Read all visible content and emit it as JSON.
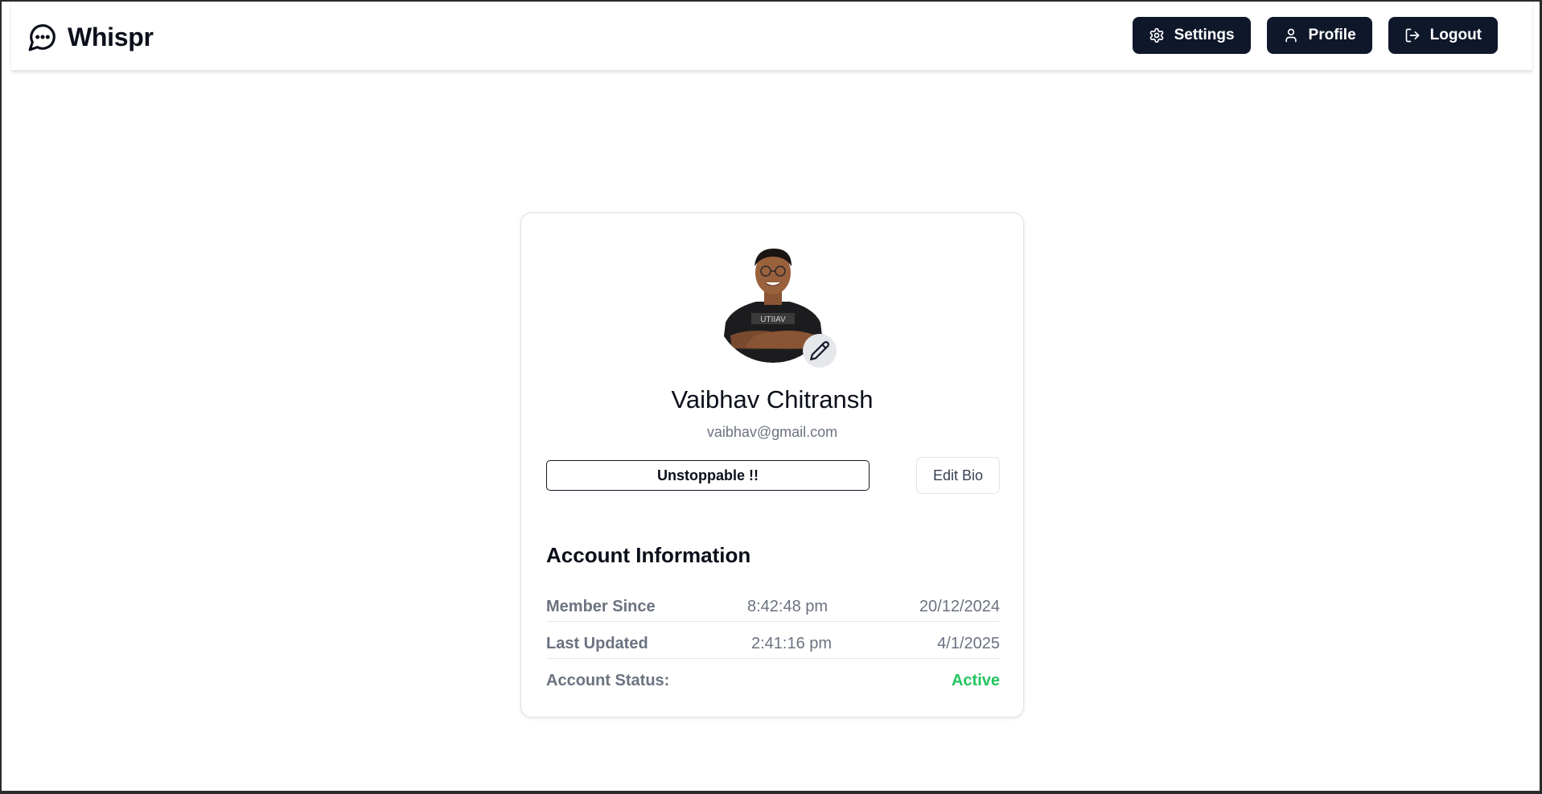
{
  "app": {
    "name": "Whispr"
  },
  "nav": {
    "settings_label": "Settings",
    "profile_label": "Profile",
    "logout_label": "Logout"
  },
  "profile": {
    "name": "Vaibhav Chitransh",
    "email": "vaibhav@gmail.com",
    "bio": "Unstoppable !!",
    "edit_bio_label": "Edit Bio",
    "avatar_alt": "profile photo"
  },
  "account": {
    "title": "Account Information",
    "member_since": {
      "label": "Member Since",
      "time": "8:42:48 pm",
      "date": "20/12/2024"
    },
    "last_updated": {
      "label": "Last Updated",
      "time": "2:41:16 pm",
      "date": "4/1/2025"
    },
    "status": {
      "label": "Account Status:",
      "value": "Active"
    }
  },
  "colors": {
    "primary_button": "#0f172a",
    "status_active": "#22c55e",
    "muted_text": "#6b7280"
  },
  "icons": {
    "brand": "message-circle-icon",
    "settings": "gear-icon",
    "profile": "user-icon",
    "logout": "logout-icon",
    "edit_avatar": "pencil-icon"
  }
}
